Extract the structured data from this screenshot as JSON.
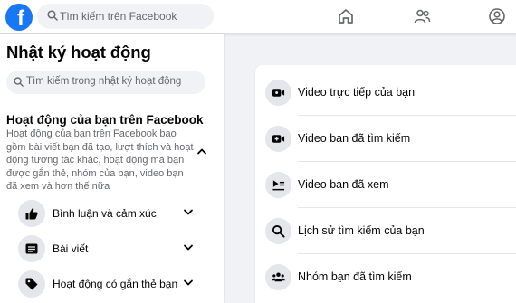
{
  "topbar": {
    "logo_letter": "f",
    "search_placeholder": "Tìm kiếm trên Facebook",
    "nav_icons": [
      "home-icon",
      "friends-icon",
      "account-icon"
    ]
  },
  "sidebar": {
    "title": "Nhật ký hoạt động",
    "search_placeholder": "Tìm kiếm trong nhật ký hoạt động",
    "section": {
      "title": "Hoạt động của bạn trên Facebook",
      "description": "Hoạt động của bạn trên Facebook bao gồm bài viết bạn đã tạo, lượt thích và hoạt động tương tác khác, hoạt động mà bạn được gắn thẻ, nhóm của bạn, video bạn đã xem và hơn thế nữa"
    },
    "items": [
      {
        "label": "Bình luận và cảm xúc",
        "icon": "thumbs-up-icon"
      },
      {
        "label": "Bài viết",
        "icon": "post-icon"
      },
      {
        "label": "Hoạt động có gắn thẻ bạn",
        "icon": "tag-icon"
      }
    ]
  },
  "main": {
    "items": [
      {
        "label": "Video trực tiếp của bạn",
        "icon": "live-video-icon"
      },
      {
        "label": "Video bạn đã tìm kiếm",
        "icon": "video-search-icon"
      },
      {
        "label": "Video bạn đã xem",
        "icon": "video-watched-icon"
      },
      {
        "label": "Lịch sử tìm kiếm của bạn",
        "icon": "search-icon"
      },
      {
        "label": "Nhóm bạn đã tìm kiếm",
        "icon": "groups-icon"
      }
    ]
  },
  "colors": {
    "brand": "#1877f2",
    "background": "#f0f2f5",
    "text_primary": "#050505",
    "text_secondary": "#65676b"
  }
}
